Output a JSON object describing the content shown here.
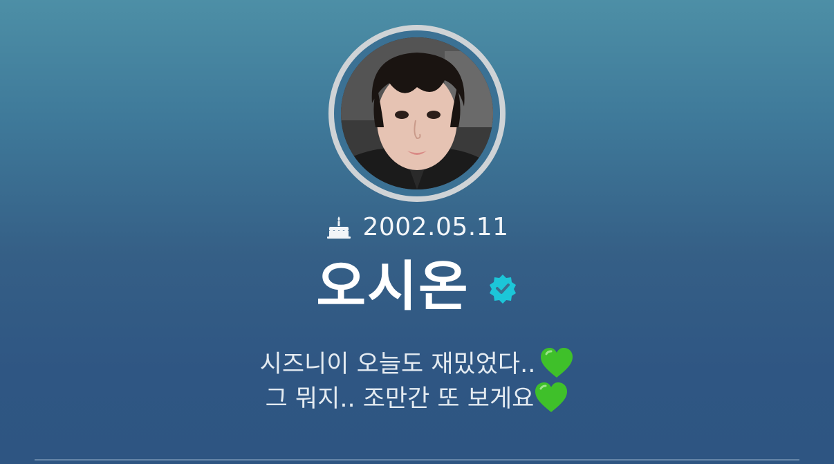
{
  "profile": {
    "avatar_alt": "profile photo",
    "birthday": "2002.05.11",
    "name": "오시온",
    "verified": true,
    "bio": {
      "line1": "시즈니이 오늘도 재밌었다..",
      "line2": "그 뭐지.. 조만간 또 보게요"
    }
  },
  "icons": {
    "birthday": "cake-icon",
    "verified": "verified-badge-icon",
    "heart": "green-heart-icon"
  },
  "colors": {
    "background_top": "#4d8fa6",
    "background_bottom": "#2e5582",
    "verified_badge": "#1cc6d8",
    "heart": "#3fc02a",
    "text": "#ffffff"
  }
}
